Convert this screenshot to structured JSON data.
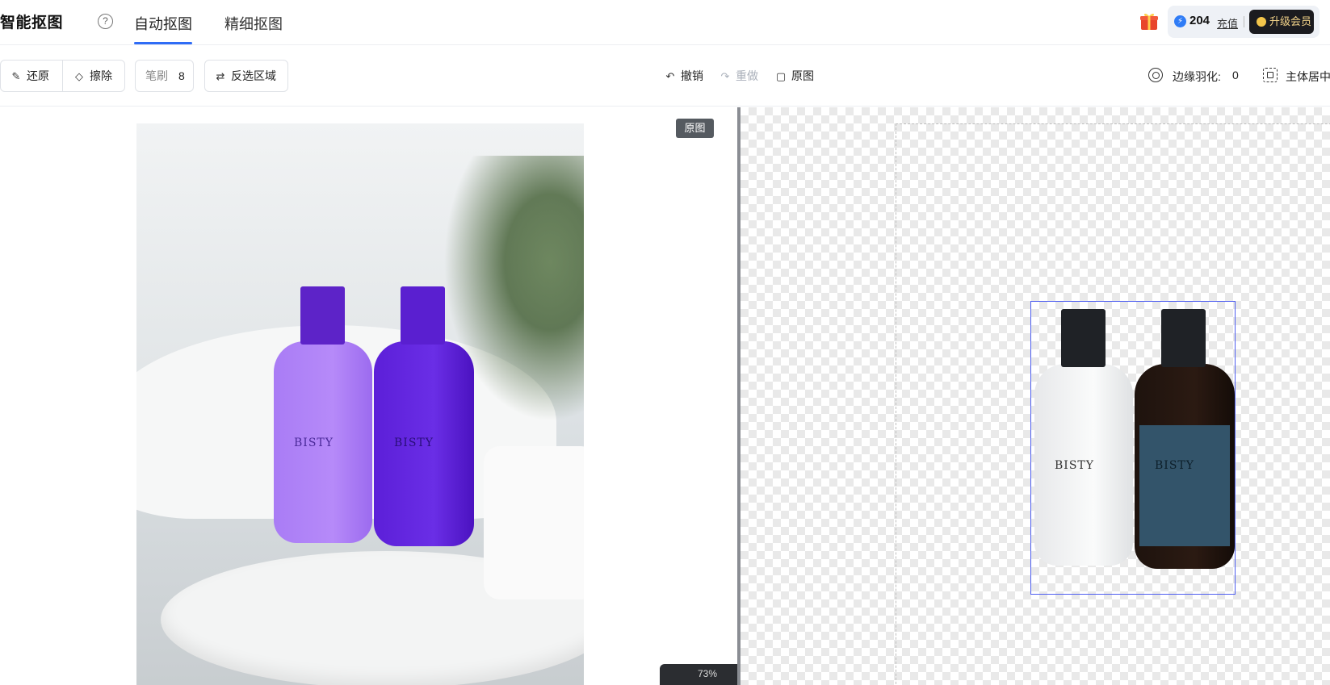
{
  "header": {
    "app_title": "智能抠图",
    "help_symbol": "?",
    "tabs": [
      {
        "label": "自动抠图",
        "active": true
      },
      {
        "label": "精细抠图",
        "active": false
      }
    ],
    "credits": {
      "count": "204",
      "recharge_label": "充值"
    },
    "upgrade_label": "升级会员",
    "accent_color": "#2f6cf6"
  },
  "toolbar": {
    "restore_label": "还原",
    "erase_label": "擦除",
    "brush_label": "笔刷",
    "brush_size": "8",
    "invert_label": "反选区域",
    "undo_label": "撤销",
    "redo_label": "重做",
    "original_label": "原图",
    "feather_label": "边缘羽化:",
    "feather_value": "0",
    "center_label": "主体居中"
  },
  "canvas": {
    "original_badge": "原图",
    "product_brand": "BISTY",
    "zoom_level": "73%"
  }
}
